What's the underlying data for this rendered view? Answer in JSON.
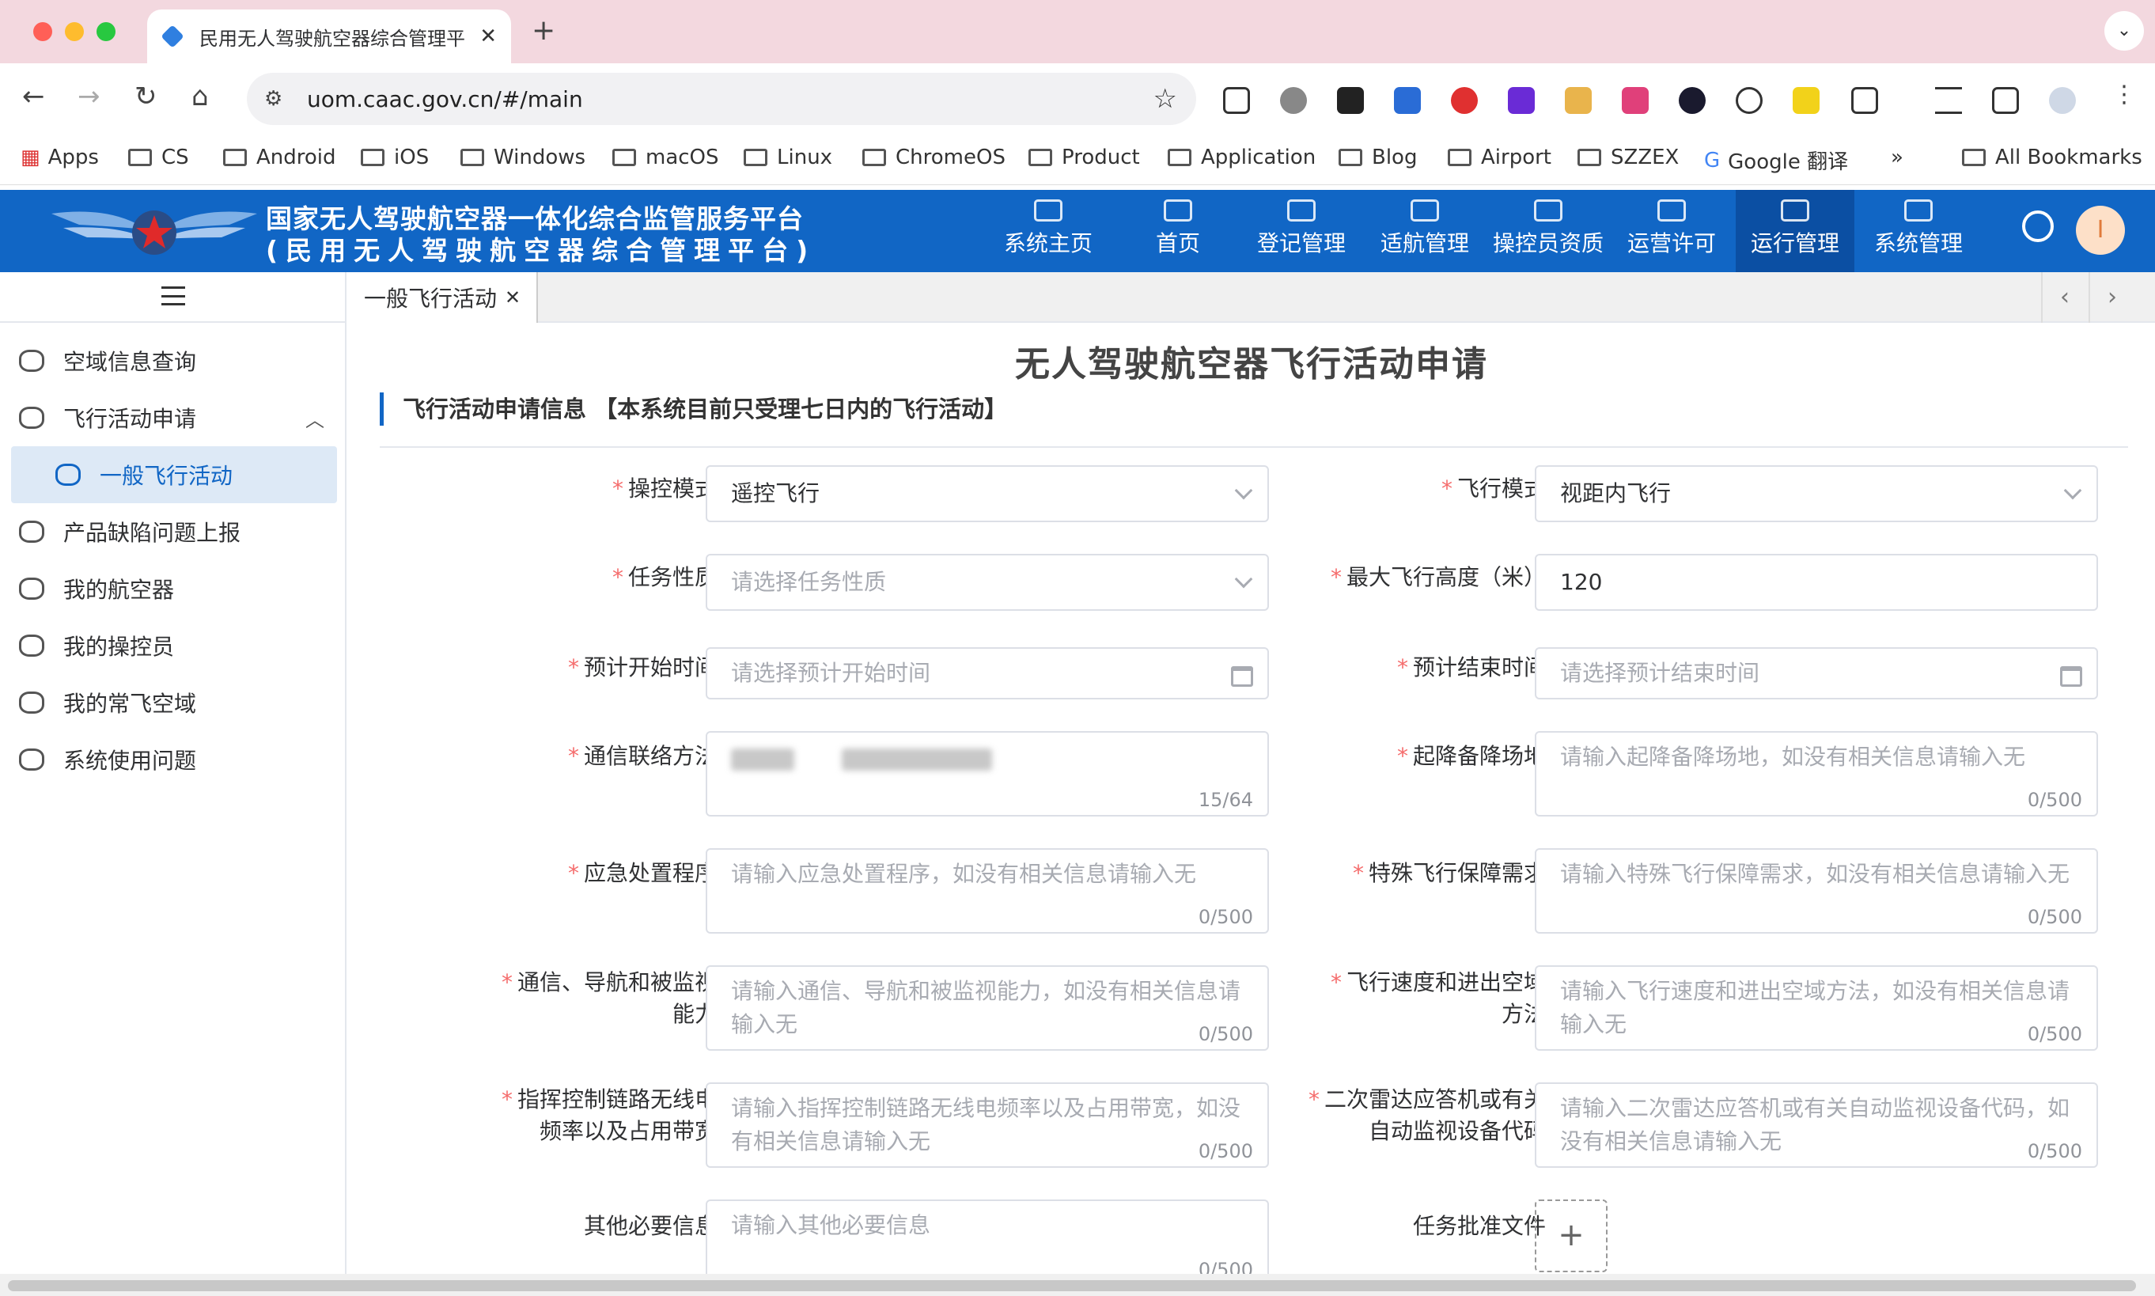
{
  "browser": {
    "tab_title": "民用无人驾驶航空器综合管理平",
    "url": "uom.caac.gov.cn/#/main",
    "bookmarks": [
      "Apps",
      "CS",
      "Android",
      "iOS",
      "Windows",
      "macOS",
      "Linux",
      "ChromeOS",
      "Product",
      "Application",
      "Blog",
      "Airport",
      "SZZEX",
      "Google 翻译",
      "»",
      "All Bookmarks"
    ]
  },
  "header": {
    "brand_line1": "国家无人驾驶航空器一体化综合监管服务平台",
    "brand_line2": "(民用无人驾驶航空器综合管理平台)",
    "menu": [
      "系统主页",
      "首页",
      "登记管理",
      "适航管理",
      "操控员资质",
      "运营许可",
      "运行管理",
      "系统管理"
    ],
    "active_menu": "运行管理",
    "avatar": "I"
  },
  "sidebar": {
    "items": [
      "空域信息查询",
      "飞行活动申请",
      "一般飞行活动",
      "产品缺陷问题上报",
      "我的航空器",
      "我的操控员",
      "我的常飞空域",
      "系统使用问题"
    ]
  },
  "page_tab": "一般飞行活动",
  "form": {
    "title": "无人驾驶航空器飞行活动申请",
    "section": "飞行活动申请信息 【本系统目前只受理七日内的飞行活动】",
    "fields": [
      {
        "label": "操控模式",
        "value": "遥控飞行",
        "placeholder": "",
        "required": true
      },
      {
        "label": "飞行模式",
        "value": "视距内飞行",
        "placeholder": "",
        "required": true
      },
      {
        "label": "任务性质",
        "value": "",
        "placeholder": "请选择任务性质",
        "required": true
      },
      {
        "label": "最大飞行高度（米）",
        "value": "120",
        "placeholder": "",
        "required": true
      },
      {
        "label": "预计开始时间",
        "value": "",
        "placeholder": "请选择预计开始时间",
        "required": true
      },
      {
        "label": "预计结束时间",
        "value": "",
        "placeholder": "请选择预计结束时间",
        "required": true
      },
      {
        "label": "通信联络方法",
        "value": "",
        "placeholder": "",
        "required": true,
        "count": "15/64"
      },
      {
        "label": "起降备降场地",
        "value": "",
        "placeholder": "请输入起降备降场地，如没有相关信息请输入无",
        "required": true,
        "count": "0/500"
      },
      {
        "label": "应急处置程序",
        "value": "",
        "placeholder": "请输入应急处置程序，如没有相关信息请输入无",
        "required": true,
        "count": "0/500"
      },
      {
        "label": "特殊飞行保障需求",
        "value": "",
        "placeholder": "请输入特殊飞行保障需求，如没有相关信息请输入无",
        "required": true,
        "count": "0/500"
      },
      {
        "label": "通信、导航和被监视能力",
        "value": "",
        "placeholder": "请输入通信、导航和被监视能力，如没有相关信息请输入无",
        "required": true,
        "count": "0/500"
      },
      {
        "label": "飞行速度和进出空域方法",
        "value": "",
        "placeholder": "请输入飞行速度和进出空域方法，如没有相关信息请输入无",
        "required": true,
        "count": "0/500"
      },
      {
        "label": "指挥控制链路无线电频率以及占用带宽",
        "value": "",
        "placeholder": "请输入指挥控制链路无线电频率以及占用带宽，如没有相关信息请输入无",
        "required": true,
        "count": "0/500"
      },
      {
        "label": "二次雷达应答机或有关自动监视设备代码",
        "value": "",
        "placeholder": "请输入二次雷达应答机或有关自动监视设备代码，如没有相关信息请输入无",
        "required": true,
        "count": "0/500"
      },
      {
        "label": "其他必要信息",
        "value": "",
        "placeholder": "请输入其他必要信息",
        "required": false,
        "count": "0/500"
      },
      {
        "label": "任务批准文件",
        "value": "",
        "placeholder": "",
        "required": false
      }
    ],
    "upload_icon": "+"
  }
}
